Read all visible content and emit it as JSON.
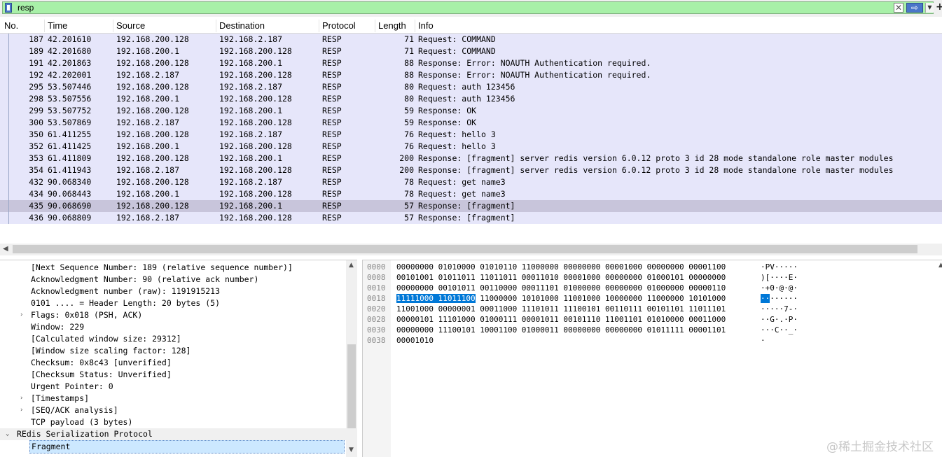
{
  "filter": {
    "value": "resp",
    "clear_label": "✕",
    "apply_label": "⇨",
    "dropdown_label": "▼",
    "add_label": "+"
  },
  "columns": [
    "No.",
    "Time",
    "Source",
    "Destination",
    "Protocol",
    "Length",
    "Info"
  ],
  "packets": [
    {
      "no": "187",
      "time": "42.201610",
      "src": "192.168.200.128",
      "dst": "192.168.2.187",
      "proto": "RESP",
      "len": "71",
      "info": "Request: COMMAND"
    },
    {
      "no": "189",
      "time": "42.201680",
      "src": "192.168.200.1",
      "dst": "192.168.200.128",
      "proto": "RESP",
      "len": "71",
      "info": "Request: COMMAND"
    },
    {
      "no": "191",
      "time": "42.201863",
      "src": "192.168.200.128",
      "dst": "192.168.200.1",
      "proto": "RESP",
      "len": "88",
      "info": "Response: Error: NOAUTH Authentication required."
    },
    {
      "no": "192",
      "time": "42.202001",
      "src": "192.168.2.187",
      "dst": "192.168.200.128",
      "proto": "RESP",
      "len": "88",
      "info": "Response: Error: NOAUTH Authentication required."
    },
    {
      "no": "295",
      "time": "53.507446",
      "src": "192.168.200.128",
      "dst": "192.168.2.187",
      "proto": "RESP",
      "len": "80",
      "info": "Request: auth 123456"
    },
    {
      "no": "298",
      "time": "53.507556",
      "src": "192.168.200.1",
      "dst": "192.168.200.128",
      "proto": "RESP",
      "len": "80",
      "info": "Request: auth 123456"
    },
    {
      "no": "299",
      "time": "53.507752",
      "src": "192.168.200.128",
      "dst": "192.168.200.1",
      "proto": "RESP",
      "len": "59",
      "info": "Response: OK"
    },
    {
      "no": "300",
      "time": "53.507869",
      "src": "192.168.2.187",
      "dst": "192.168.200.128",
      "proto": "RESP",
      "len": "59",
      "info": "Response: OK"
    },
    {
      "no": "350",
      "time": "61.411255",
      "src": "192.168.200.128",
      "dst": "192.168.2.187",
      "proto": "RESP",
      "len": "76",
      "info": "Request: hello 3"
    },
    {
      "no": "352",
      "time": "61.411425",
      "src": "192.168.200.1",
      "dst": "192.168.200.128",
      "proto": "RESP",
      "len": "76",
      "info": "Request: hello 3"
    },
    {
      "no": "353",
      "time": "61.411809",
      "src": "192.168.200.128",
      "dst": "192.168.200.1",
      "proto": "RESP",
      "len": "200",
      "info": "Response: [fragment] server redis version 6.0.12 proto 3 id 28 mode standalone role master modules"
    },
    {
      "no": "354",
      "time": "61.411943",
      "src": "192.168.2.187",
      "dst": "192.168.200.128",
      "proto": "RESP",
      "len": "200",
      "info": "Response: [fragment] server redis version 6.0.12 proto 3 id 28 mode standalone role master modules"
    },
    {
      "no": "432",
      "time": "90.068340",
      "src": "192.168.200.128",
      "dst": "192.168.2.187",
      "proto": "RESP",
      "len": "78",
      "info": "Request: get name3"
    },
    {
      "no": "434",
      "time": "90.068443",
      "src": "192.168.200.1",
      "dst": "192.168.200.128",
      "proto": "RESP",
      "len": "78",
      "info": "Request: get name3"
    },
    {
      "no": "435",
      "time": "90.068690",
      "src": "192.168.200.128",
      "dst": "192.168.200.1",
      "proto": "RESP",
      "len": "57",
      "info": "Response: [fragment]",
      "selected": true
    },
    {
      "no": "436",
      "time": "90.068809",
      "src": "192.168.2.187",
      "dst": "192.168.200.128",
      "proto": "RESP",
      "len": "57",
      "info": "Response: [fragment]"
    }
  ],
  "details": [
    {
      "text": "[Next Sequence Number: 189    (relative sequence number)]",
      "arrow": ""
    },
    {
      "text": "Acknowledgment Number: 90    (relative ack number)",
      "arrow": ""
    },
    {
      "text": "Acknowledgment number (raw): 1191915213",
      "arrow": ""
    },
    {
      "text": "0101 .... = Header Length: 20 bytes (5)",
      "arrow": ""
    },
    {
      "text": "Flags: 0x018 (PSH, ACK)",
      "arrow": ">"
    },
    {
      "text": "Window: 229",
      "arrow": ""
    },
    {
      "text": "[Calculated window size: 29312]",
      "arrow": ""
    },
    {
      "text": "[Window size scaling factor: 128]",
      "arrow": ""
    },
    {
      "text": "Checksum: 0x8c43 [unverified]",
      "arrow": ""
    },
    {
      "text": "[Checksum Status: Unverified]",
      "arrow": ""
    },
    {
      "text": "Urgent Pointer: 0",
      "arrow": ""
    },
    {
      "text": "[Timestamps]",
      "arrow": ">"
    },
    {
      "text": "[SEQ/ACK analysis]",
      "arrow": ">"
    },
    {
      "text": "TCP payload (3 bytes)",
      "arrow": ""
    },
    {
      "text": "REdis Serialization Protocol",
      "arrow": "v",
      "section": true
    },
    {
      "text": "Fragment",
      "arrow": "",
      "selected": true
    }
  ],
  "bytes": [
    {
      "offset": "0000",
      "bits": "00000000 01010000 01010110 11000000 00000000 00001000 00000000 00001100",
      "ascii": "·PV·····"
    },
    {
      "offset": "0008",
      "bits": "00101001 01011011 11011011 00011010 00001000 00000000 01000101 00000000",
      "ascii": ")[····E·"
    },
    {
      "offset": "0010",
      "bits": "00000000 00101011 00110000 00011101 01000000 00000000 01000000 00000110",
      "ascii": "·+0·@·@·"
    },
    {
      "offset": "0018",
      "bits_hl": "11111000 11011100",
      "bits": " 11000000 10101000 11001000 10000000 11000000 10101000",
      "ascii_hl": "··",
      "ascii": "······"
    },
    {
      "offset": "0020",
      "bits": "11001000 00000001 00011000 11101011 11100101 00110111 00101101 11011101",
      "ascii": "·····7-·"
    },
    {
      "offset": "0028",
      "bits": "00000101 11101000 01000111 00001011 00101110 11001101 01010000 00011000",
      "ascii": "··G·.·P·"
    },
    {
      "offset": "0030",
      "bits": "00000000 11100101 10001100 01000011 00000000 00000000 01011111 00001101",
      "ascii": "···C··_·"
    },
    {
      "offset": "0038",
      "bits": "00001010",
      "ascii": "·"
    }
  ],
  "watermark": "@稀土掘金技术社区"
}
